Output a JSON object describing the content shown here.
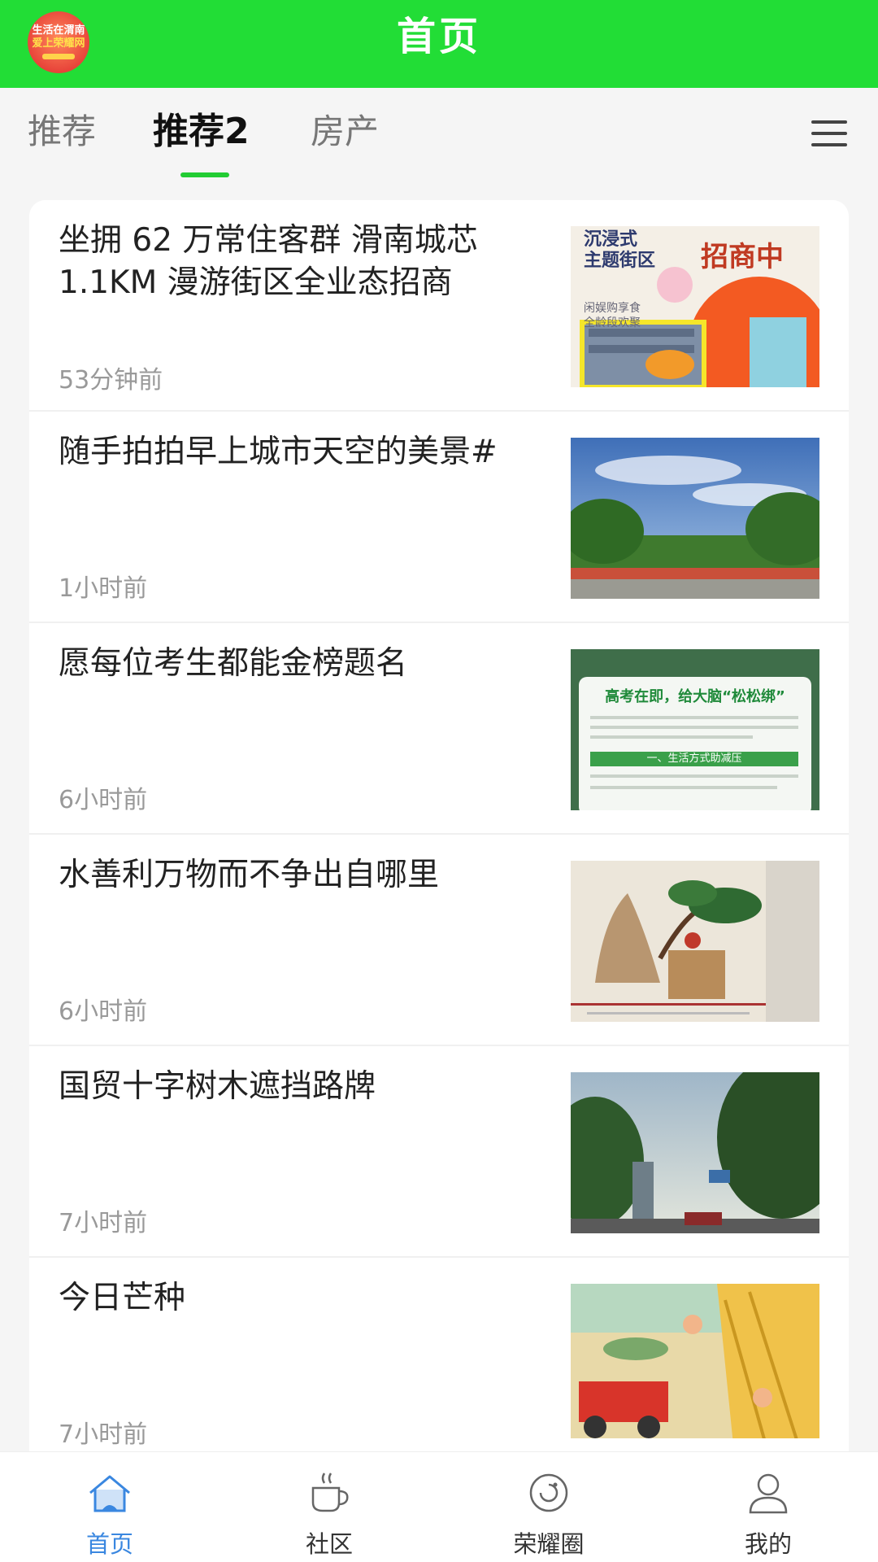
{
  "header": {
    "title": "首页",
    "logo_text_1": "生活在渭南",
    "logo_text_2": "爱上荣耀网"
  },
  "tabs": [
    {
      "label": "推荐",
      "active": false
    },
    {
      "label": "推荐2",
      "active": true
    },
    {
      "label": "房产",
      "active": false
    }
  ],
  "feed": [
    {
      "title": "坐拥 62 万常住客群 滑南城芯 1.1KM 漫游街区全业态招商",
      "time": "53分钟前",
      "image_text_1": "沉浸式",
      "image_text_2": "主题街区",
      "image_text_3": "招商中",
      "image_text_4": "闲娱购享食",
      "image_text_5": "全龄段欢聚"
    },
    {
      "title": "随手拍拍早上城市天空的美景#",
      "time": "1小时前"
    },
    {
      "title": "愿每位考生都能金榜题名",
      "time": "6小时前",
      "image_text_1": "高考在即，给大脑“松松绑”",
      "image_text_2": "一、生活方式助减压"
    },
    {
      "title": "水善利万物而不争出自哪里",
      "time": "6小时前"
    },
    {
      "title": "国贸十字树木遮挡路牌",
      "time": "7小时前"
    },
    {
      "title": "今日芒种",
      "time": "7小时前"
    }
  ],
  "bottom_nav": [
    {
      "label": "首页",
      "icon": "home-icon",
      "active": true
    },
    {
      "label": "社区",
      "icon": "coffee-cup-icon",
      "active": false
    },
    {
      "label": "荣耀圈",
      "icon": "circle-icon",
      "active": false
    },
    {
      "label": "我的",
      "icon": "user-icon",
      "active": false
    }
  ],
  "colors": {
    "header_green": "#22dd36",
    "tab_underline": "#22cc33",
    "nav_active": "#3a87e0"
  }
}
